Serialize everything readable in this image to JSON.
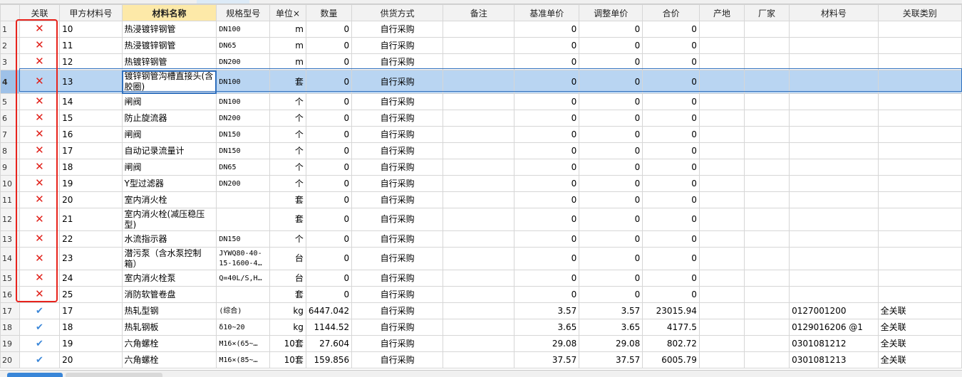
{
  "columns": [
    "关联",
    "甲方材料号",
    "材料名称",
    "规格型号",
    "单位",
    "数量",
    "供货方式",
    "备注",
    "基准单价",
    "调整单价",
    "合价",
    "产地",
    "厂家",
    "材料号",
    "关联类别"
  ],
  "header_close_glyph": "×",
  "icons": {
    "unlinked": "x-icon",
    "linked": "check-icon"
  },
  "colors": {
    "unlinked_red": "#e0201a",
    "linked_blue": "#3a86d8",
    "selected_row": "#b9d5f2",
    "highlight_border": "#e8231c"
  },
  "rows": [
    {
      "n": "1",
      "linked": false,
      "code": "10",
      "name": "热浸镀锌钢管",
      "spec": "DN100",
      "unit": "m",
      "qty": "0",
      "supply": "自行采购",
      "note": "",
      "base": "0",
      "adj": "0",
      "total": "0",
      "origin": "",
      "maker": "",
      "matno": "",
      "category": ""
    },
    {
      "n": "2",
      "linked": false,
      "code": "11",
      "name": "热浸镀锌钢管",
      "spec": "DN65",
      "unit": "m",
      "qty": "0",
      "supply": "自行采购",
      "note": "",
      "base": "0",
      "adj": "0",
      "total": "0",
      "origin": "",
      "maker": "",
      "matno": "",
      "category": ""
    },
    {
      "n": "3",
      "linked": false,
      "code": "12",
      "name": "热镀锌钢管",
      "spec": "DN200",
      "unit": "m",
      "qty": "0",
      "supply": "自行采购",
      "note": "",
      "base": "0",
      "adj": "0",
      "total": "0",
      "origin": "",
      "maker": "",
      "matno": "",
      "category": ""
    },
    {
      "n": "4",
      "linked": false,
      "code": "13",
      "name": "镀锌钢管沟槽直接头(含胶圈)",
      "spec": "DN100",
      "unit": "套",
      "qty": "0",
      "supply": "自行采购",
      "note": "",
      "base": "0",
      "adj": "0",
      "total": "0",
      "origin": "",
      "maker": "",
      "matno": "",
      "category": ""
    },
    {
      "n": "5",
      "linked": false,
      "code": "14",
      "name": "闸阀",
      "spec": "DN100",
      "unit": "个",
      "qty": "0",
      "supply": "自行采购",
      "note": "",
      "base": "0",
      "adj": "0",
      "total": "0",
      "origin": "",
      "maker": "",
      "matno": "",
      "category": ""
    },
    {
      "n": "6",
      "linked": false,
      "code": "15",
      "name": "防止旋流器",
      "spec": "DN200",
      "unit": "个",
      "qty": "0",
      "supply": "自行采购",
      "note": "",
      "base": "0",
      "adj": "0",
      "total": "0",
      "origin": "",
      "maker": "",
      "matno": "",
      "category": ""
    },
    {
      "n": "7",
      "linked": false,
      "code": "16",
      "name": "闸阀",
      "spec": "DN150",
      "unit": "个",
      "qty": "0",
      "supply": "自行采购",
      "note": "",
      "base": "0",
      "adj": "0",
      "total": "0",
      "origin": "",
      "maker": "",
      "matno": "",
      "category": ""
    },
    {
      "n": "8",
      "linked": false,
      "code": "17",
      "name": "自动记录流量计",
      "spec": "DN150",
      "unit": "个",
      "qty": "0",
      "supply": "自行采购",
      "note": "",
      "base": "0",
      "adj": "0",
      "total": "0",
      "origin": "",
      "maker": "",
      "matno": "",
      "category": ""
    },
    {
      "n": "9",
      "linked": false,
      "code": "18",
      "name": "闸阀",
      "spec": "DN65",
      "unit": "个",
      "qty": "0",
      "supply": "自行采购",
      "note": "",
      "base": "0",
      "adj": "0",
      "total": "0",
      "origin": "",
      "maker": "",
      "matno": "",
      "category": ""
    },
    {
      "n": "10",
      "linked": false,
      "code": "19",
      "name": "Y型过滤器",
      "spec": "DN200",
      "unit": "个",
      "qty": "0",
      "supply": "自行采购",
      "note": "",
      "base": "0",
      "adj": "0",
      "total": "0",
      "origin": "",
      "maker": "",
      "matno": "",
      "category": ""
    },
    {
      "n": "11",
      "linked": false,
      "code": "20",
      "name": "室内消火栓",
      "spec": "",
      "unit": "套",
      "qty": "0",
      "supply": "自行采购",
      "note": "",
      "base": "0",
      "adj": "0",
      "total": "0",
      "origin": "",
      "maker": "",
      "matno": "",
      "category": ""
    },
    {
      "n": "12",
      "linked": false,
      "code": "21",
      "name": "室内消火栓(减压稳压型)",
      "spec": "",
      "unit": "套",
      "qty": "0",
      "supply": "自行采购",
      "note": "",
      "base": "0",
      "adj": "0",
      "total": "0",
      "origin": "",
      "maker": "",
      "matno": "",
      "category": ""
    },
    {
      "n": "13",
      "linked": false,
      "code": "22",
      "name": "水流指示器",
      "spec": "DN150",
      "unit": "个",
      "qty": "0",
      "supply": "自行采购",
      "note": "",
      "base": "0",
      "adj": "0",
      "total": "0",
      "origin": "",
      "maker": "",
      "matno": "",
      "category": ""
    },
    {
      "n": "14",
      "linked": false,
      "code": "23",
      "name": "潜污泵（含水泵控制箱）",
      "spec": "JYWQ80-40-15-1600-4…",
      "unit": "台",
      "qty": "0",
      "supply": "自行采购",
      "note": "",
      "base": "0",
      "adj": "0",
      "total": "0",
      "origin": "",
      "maker": "",
      "matno": "",
      "category": ""
    },
    {
      "n": "15",
      "linked": false,
      "code": "24",
      "name": "室内消火栓泵",
      "spec": "Q=40L/S,H…",
      "unit": "台",
      "qty": "0",
      "supply": "自行采购",
      "note": "",
      "base": "0",
      "adj": "0",
      "total": "0",
      "origin": "",
      "maker": "",
      "matno": "",
      "category": ""
    },
    {
      "n": "16",
      "linked": false,
      "code": "25",
      "name": "消防软管卷盘",
      "spec": "",
      "unit": "套",
      "qty": "0",
      "supply": "自行采购",
      "note": "",
      "base": "0",
      "adj": "0",
      "total": "0",
      "origin": "",
      "maker": "",
      "matno": "",
      "category": ""
    },
    {
      "n": "17",
      "linked": true,
      "code": "17",
      "name": "热轧型钢",
      "spec": "(综合)",
      "unit": "kg",
      "qty": "6447.042",
      "supply": "自行采购",
      "note": "",
      "base": "3.57",
      "adj": "3.57",
      "total": "23015.94",
      "origin": "",
      "maker": "",
      "matno": "0127001200",
      "category": "全关联"
    },
    {
      "n": "18",
      "linked": true,
      "code": "18",
      "name": "热轧钢板",
      "spec": "δ10~20",
      "unit": "kg",
      "qty": "1144.52",
      "supply": "自行采购",
      "note": "",
      "base": "3.65",
      "adj": "3.65",
      "total": "4177.5",
      "origin": "",
      "maker": "",
      "matno": "0129016206  @1",
      "category": "全关联"
    },
    {
      "n": "19",
      "linked": true,
      "code": "19",
      "name": "六角螺栓",
      "spec": "M16×(65~…",
      "unit": "10套",
      "qty": "27.604",
      "supply": "自行采购",
      "note": "",
      "base": "29.08",
      "adj": "29.08",
      "total": "802.72",
      "origin": "",
      "maker": "",
      "matno": "0301081212",
      "category": "全关联"
    },
    {
      "n": "20",
      "linked": true,
      "code": "20",
      "name": "六角螺栓",
      "spec": "M16×(85~…",
      "unit": "10套",
      "qty": "159.856",
      "supply": "自行采购",
      "note": "",
      "base": "37.57",
      "adj": "37.57",
      "total": "6005.79",
      "origin": "",
      "maker": "",
      "matno": "0301081213",
      "category": "全关联"
    }
  ]
}
